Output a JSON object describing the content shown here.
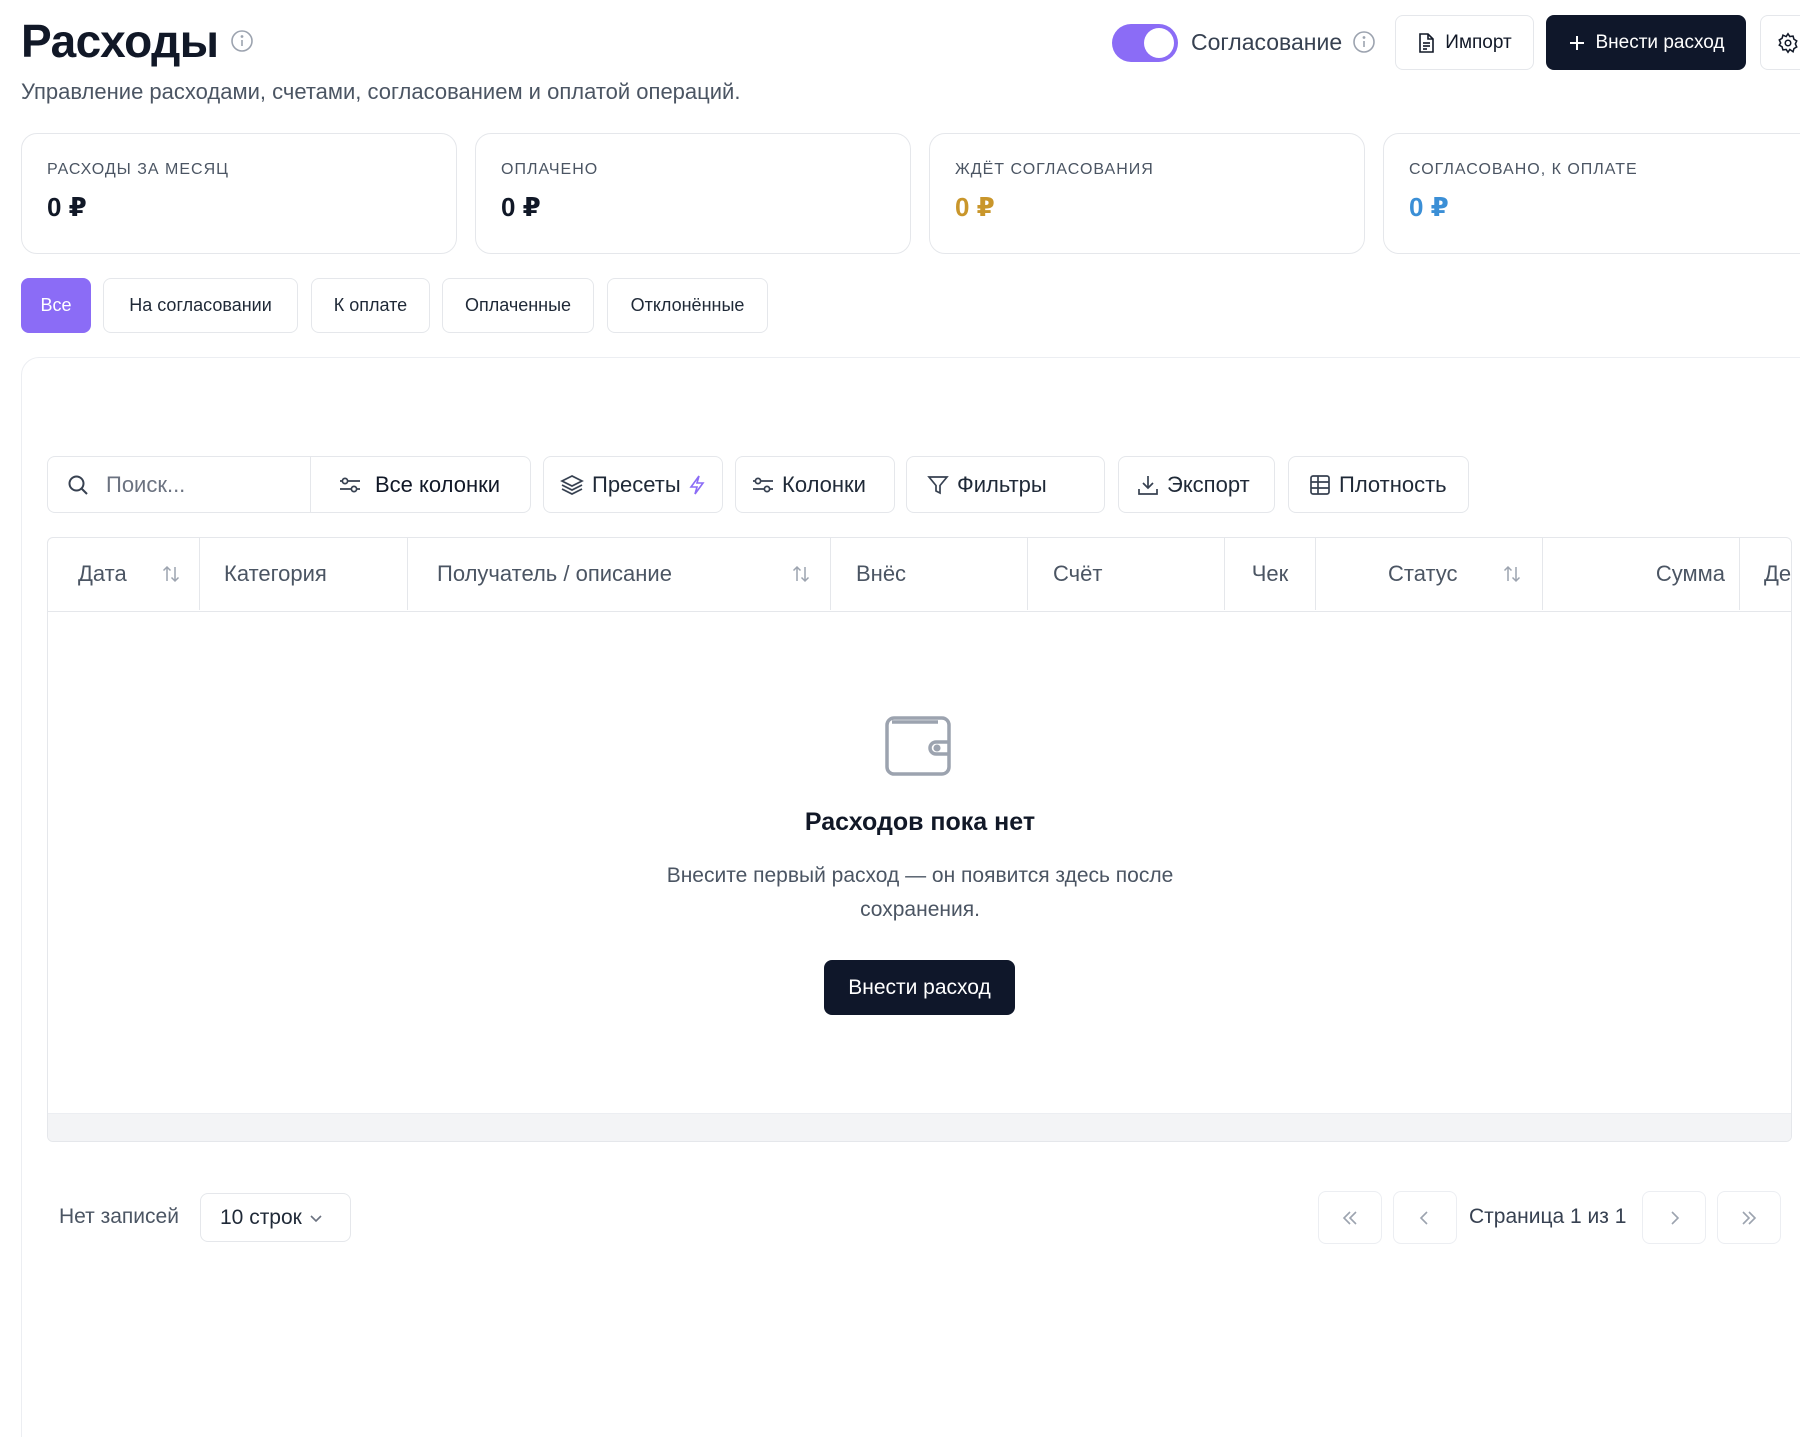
{
  "header": {
    "title": "Расходы",
    "subtitle": "Управление расходами, счетами, согласованием и оплатой операций.",
    "approval_label": "Согласование",
    "approval_enabled": true,
    "import_label": "Импорт",
    "add_expense_label": "Внести расход"
  },
  "stats": [
    {
      "label": "РАСХОДЫ ЗА МЕСЯЦ",
      "value": "0 ₽",
      "color": "#111827"
    },
    {
      "label": "ОПЛАЧЕНО",
      "value": "0 ₽",
      "color": "#111827"
    },
    {
      "label": "ЖДЁТ СОГЛАСОВАНИЯ",
      "value": "0 ₽",
      "color": "#c9962b"
    },
    {
      "label": "СОГЛАСОВАНО, К ОПЛАТЕ",
      "value": "0 ₽",
      "color": "#3b8fd6"
    }
  ],
  "tabs": [
    {
      "label": "Все",
      "active": true
    },
    {
      "label": "На согласовании",
      "active": false
    },
    {
      "label": "К оплате",
      "active": false
    },
    {
      "label": "Оплаченные",
      "active": false
    },
    {
      "label": "Отклонённые",
      "active": false
    }
  ],
  "toolbar": {
    "search_placeholder": "Поиск...",
    "all_columns_label": "Все колонки",
    "presets_label": "Пресеты",
    "columns_label": "Колонки",
    "filters_label": "Фильтры",
    "export_label": "Экспорт",
    "density_label": "Плотность"
  },
  "table": {
    "columns": [
      "Дата",
      "Категория",
      "Получатель / описание",
      "Внёс",
      "Счёт",
      "Чек",
      "Статус",
      "Сумма",
      "Де"
    ]
  },
  "empty_state": {
    "title": "Расходов пока нет",
    "text": "Внесите первый расход — он появится здесь после сохранения.",
    "button_label": "Внести расход"
  },
  "pagination": {
    "records_label": "Нет записей",
    "rows_per_page": "10 строк",
    "page_label": "Страница 1 из 1"
  },
  "colors": {
    "accent": "#8b6cf6",
    "primary_dark": "#0f172a",
    "pending": "#c9962b",
    "approved": "#3b8fd6"
  }
}
